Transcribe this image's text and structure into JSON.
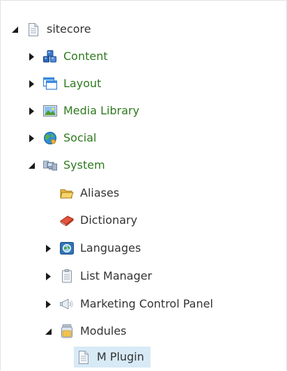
{
  "tree": {
    "root": {
      "label": "sitecore",
      "state": "expanded",
      "icon": "document-icon"
    },
    "items": [
      {
        "key": "content",
        "label": "Content",
        "state": "collapsed",
        "icon": "content-cubes-icon",
        "color": "#2f7a1f"
      },
      {
        "key": "layout",
        "label": "Layout",
        "state": "collapsed",
        "icon": "layout-window-icon",
        "color": "#2f7a1f"
      },
      {
        "key": "media-library",
        "label": "Media Library",
        "state": "collapsed",
        "icon": "image-icon",
        "color": "#2f7a1f"
      },
      {
        "key": "social",
        "label": "Social",
        "state": "collapsed",
        "icon": "globe-icon",
        "color": "#2f7a1f"
      },
      {
        "key": "system",
        "label": "System",
        "state": "expanded",
        "icon": "system-icon",
        "color": "#2f7a1f"
      }
    ],
    "system_children": [
      {
        "key": "aliases",
        "label": "Aliases",
        "state": "leaf",
        "icon": "folder-icon"
      },
      {
        "key": "dictionary",
        "label": "Dictionary",
        "state": "leaf",
        "icon": "book-icon"
      },
      {
        "key": "languages",
        "label": "Languages",
        "state": "collapsed",
        "icon": "languages-globe-icon"
      },
      {
        "key": "list-manager",
        "label": "List Manager",
        "state": "collapsed",
        "icon": "clipboard-icon"
      },
      {
        "key": "marketing-control-panel",
        "label": "Marketing Control Panel",
        "state": "collapsed",
        "icon": "megaphone-icon"
      },
      {
        "key": "modules",
        "label": "Modules",
        "state": "expanded",
        "icon": "jar-icon"
      }
    ],
    "modules_children": [
      {
        "key": "m-plugin",
        "label": "M Plugin",
        "state": "leaf",
        "icon": "document-icon",
        "selected": true
      }
    ]
  },
  "colors": {
    "green_label": "#2f7a1f",
    "dark_label": "#333333",
    "selection": "#d7eaf6",
    "toggle": "#1a1a1a"
  }
}
